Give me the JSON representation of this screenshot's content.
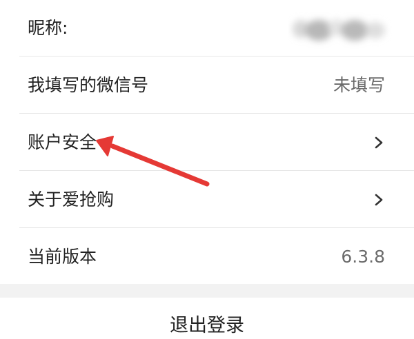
{
  "settings": {
    "nickname": {
      "label": "昵称:"
    },
    "wechat_id": {
      "label": "我填写的微信号",
      "value": "未填写"
    },
    "account_security": {
      "label": "账户安全"
    },
    "about": {
      "label": "关于爱抢购"
    },
    "version": {
      "label": "当前版本",
      "value": "6.3.8"
    }
  },
  "logout": {
    "label": "退出登录"
  },
  "colors": {
    "annotation_arrow": "#e53935",
    "divider": "#e6e6e6",
    "background": "#f2f2f2"
  },
  "icons": {
    "row_chevron": "chevron-right-icon",
    "annotation": "red-arrow-annotation"
  }
}
